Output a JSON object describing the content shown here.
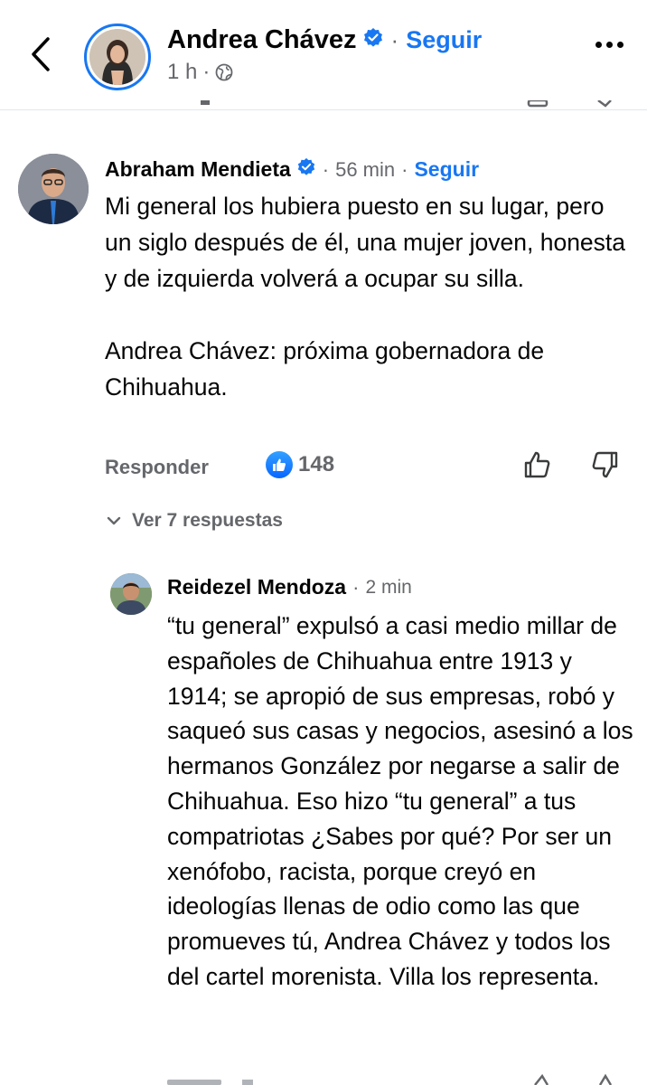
{
  "header": {
    "author_name": "Andrea Chávez",
    "follow_label": "Seguir",
    "time": "1 h",
    "dot": "·"
  },
  "comments": [
    {
      "author": "Abraham Mendieta",
      "time": "56 min",
      "follow_label": "Seguir",
      "paragraphs": [
        "Mi general los hubiera puesto en su lugar, pero un siglo después de él, una mujer joven, honesta y de izquierda volverá a ocupar su silla.",
        "Andrea Chávez: próxima gobernadora de Chihuahua."
      ],
      "reply_label": "Responder",
      "like_count": "148",
      "view_replies_label": "Ver 7 respuestas"
    }
  ],
  "replies": [
    {
      "author": "Reidezel Mendoza",
      "time": "2 min",
      "text": "“tu general” expulsó a casi medio millar de españoles de Chihuahua entre 1913 y 1914; se apropió de sus empresas, robó y saqueó sus casas y negocios, asesinó a los hermanos González por negarse a salir de Chihuahua. Eso hizo “tu general” a tus compatriotas ¿Sabes por qué? Por ser un xenófobo, racista, porque creyó en ideologías llenas de odio como las que promueves tú, Andrea Chávez y todos los del cartel morenista. Villa los representa."
    }
  ],
  "colors": {
    "accent": "#1877f2",
    "secondary_text": "#65676b",
    "primary_text": "#050505"
  },
  "icons": [
    "back-arrow-icon",
    "verified-badge-icon",
    "globe-icon",
    "more-options-icon",
    "like-reaction-icon",
    "thumbs-up-icon",
    "thumbs-down-icon",
    "chevron-down-icon"
  ]
}
